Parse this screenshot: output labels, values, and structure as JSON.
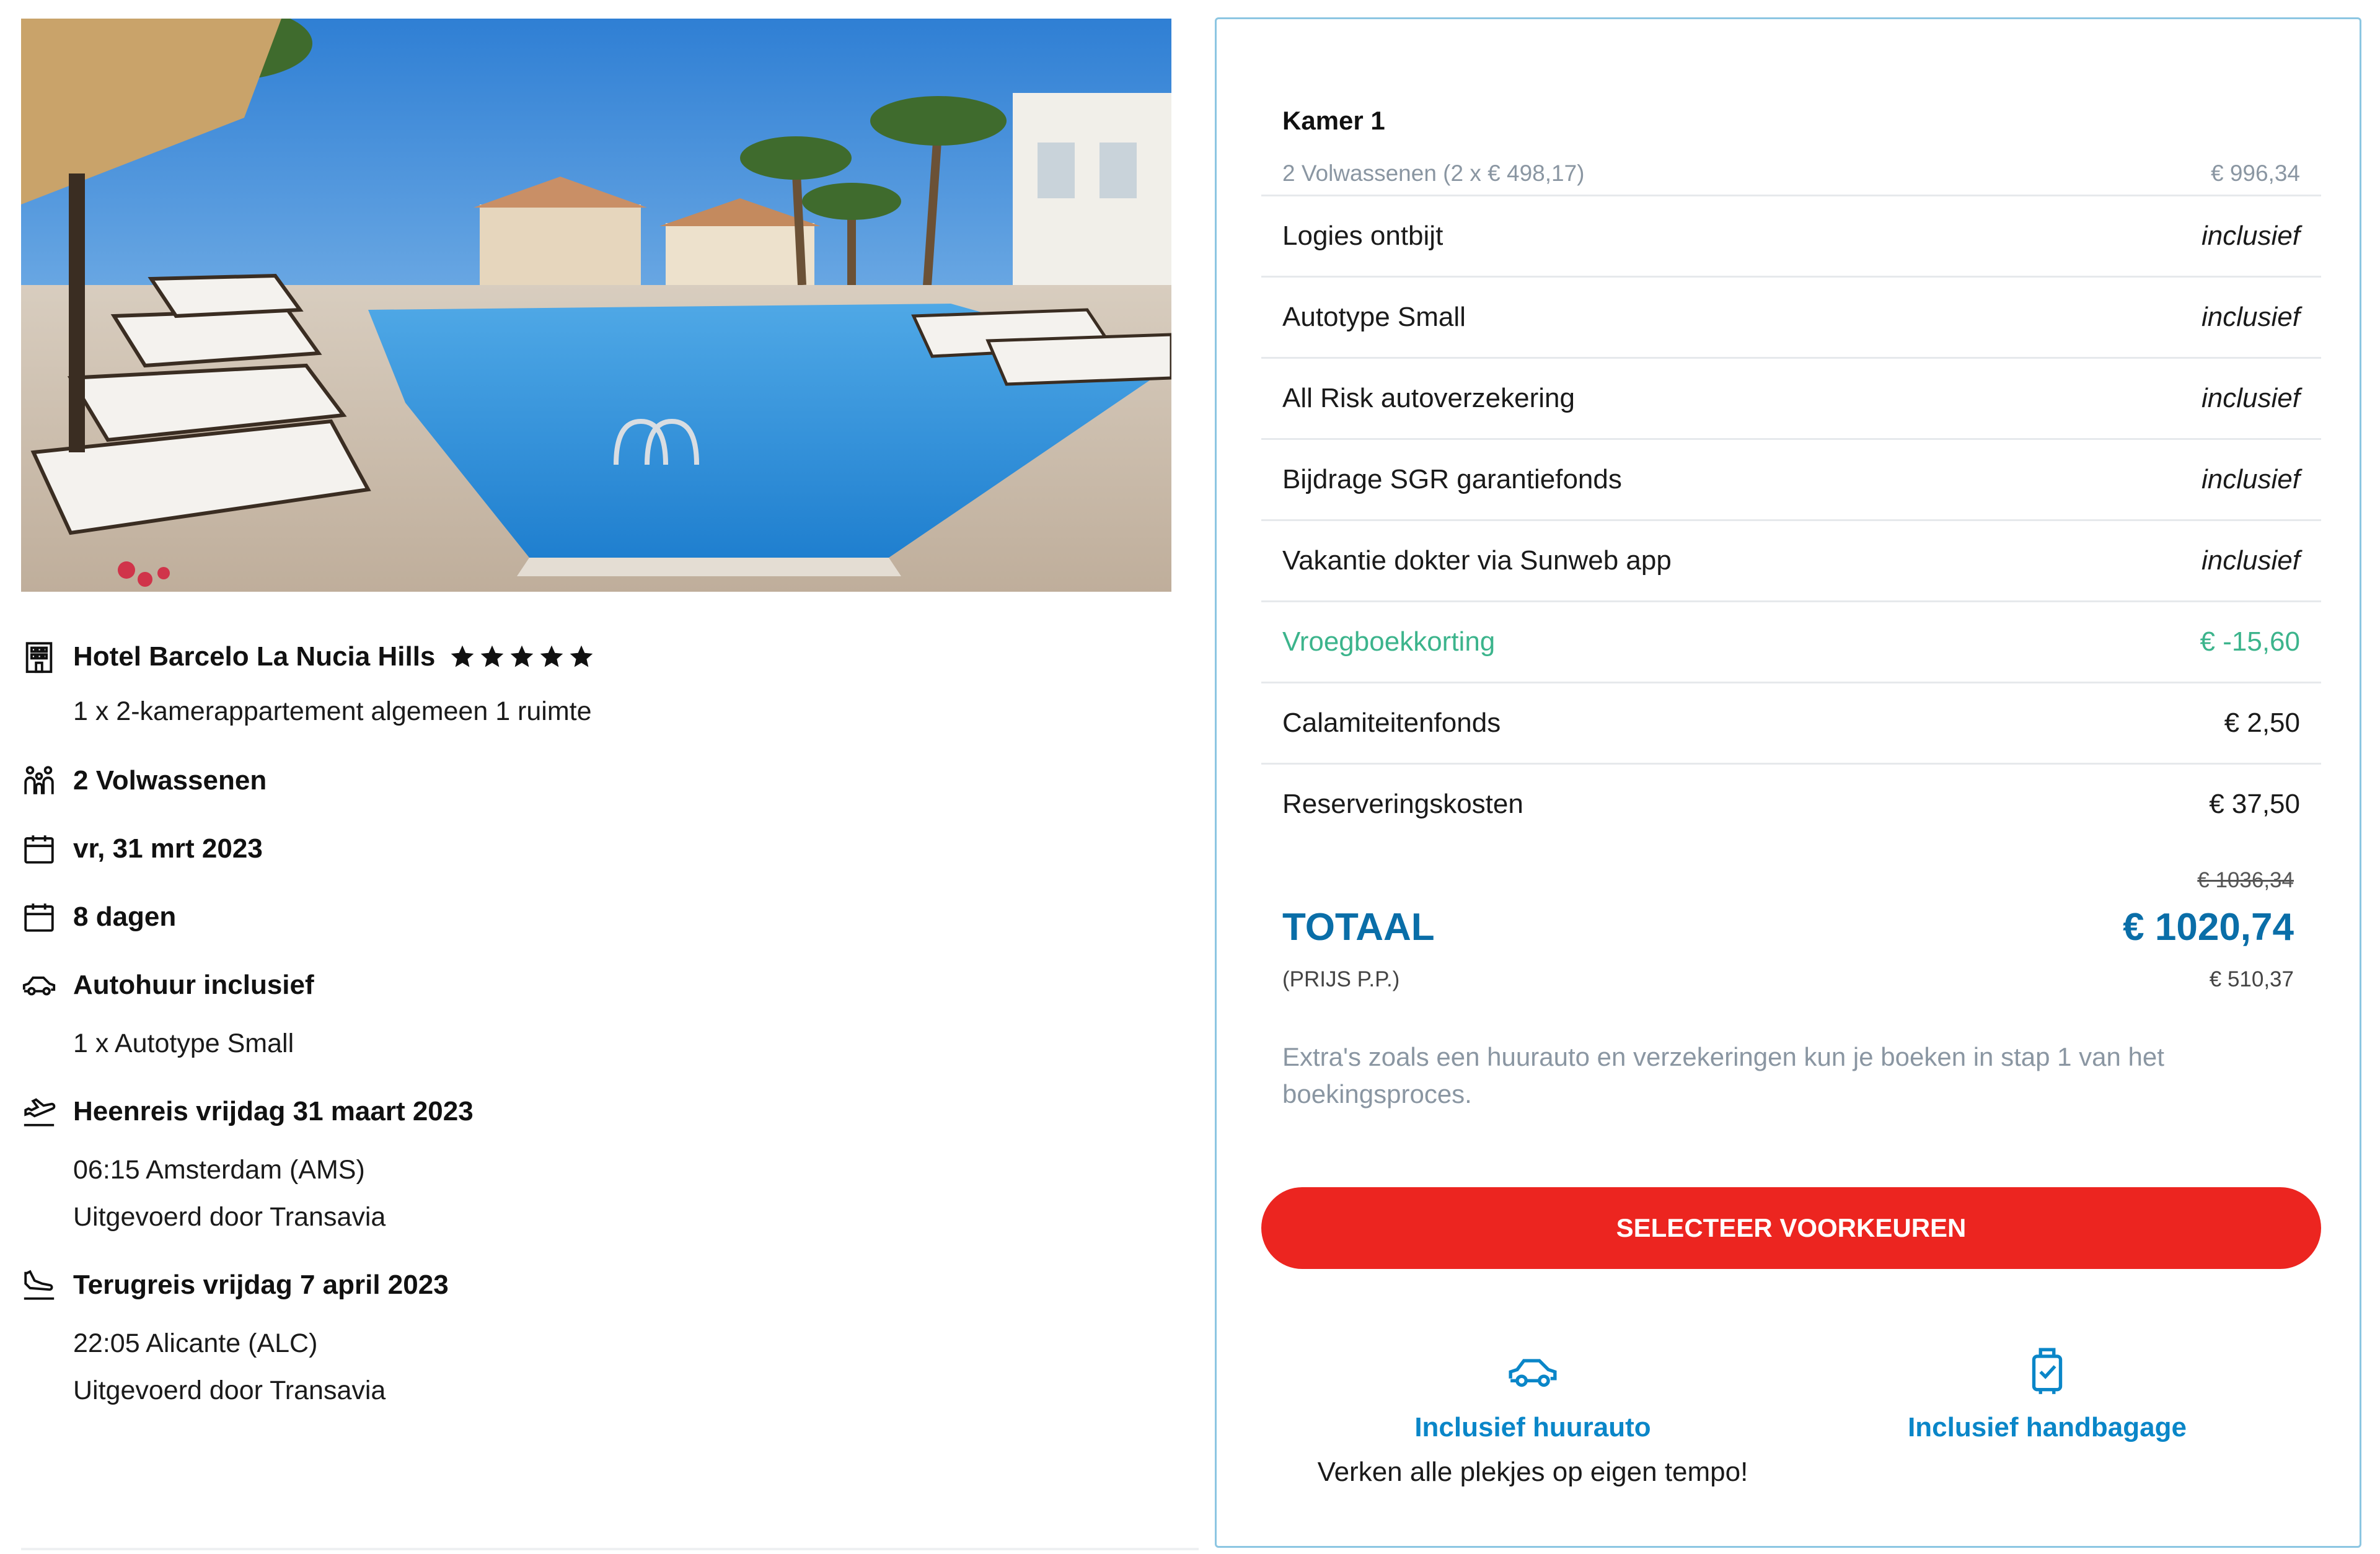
{
  "hotel_photo": {
    "icon": "hotel-pool-photo"
  },
  "details": {
    "hotel": {
      "icon": "building-icon",
      "name": "Hotel Barcelo La Nucia Hills",
      "stars": 5,
      "room": "1 x 2-kamerappartement algemeen 1 ruimte"
    },
    "travellers": {
      "icon": "people-icon",
      "label": "2 Volwassenen"
    },
    "date": {
      "icon": "calendar-icon",
      "label": "vr, 31 mrt 2023"
    },
    "duration": {
      "icon": "calendar-icon",
      "label": "8 dagen"
    },
    "car": {
      "icon": "car-icon",
      "label": "Autohuur inclusief",
      "sub": "1 x Autotype Small"
    },
    "outbound": {
      "icon": "plane-takeoff-icon",
      "label": "Heenreis vrijdag 31 maart 2023",
      "time": "06:15 Amsterdam (AMS)",
      "carrier": "Uitgevoerd door Transavia"
    },
    "return": {
      "icon": "plane-landing-icon",
      "label": "Terugreis vrijdag 7 april 2023",
      "time": "22:05 Alicante (ALC)",
      "carrier": "Uitgevoerd door Transavia"
    }
  },
  "price_card": {
    "room_title": "Kamer 1",
    "room_sub_label": "2 Volwassenen (2 x € 498,17)",
    "room_sub_value": "€ 996,34",
    "items": [
      {
        "label": "Logies ontbijt",
        "value": "inclusief"
      },
      {
        "label": "Autotype Small",
        "value": "inclusief"
      },
      {
        "label": "All Risk autoverzekering",
        "value": "inclusief"
      },
      {
        "label": "Bijdrage SGR garantiefonds",
        "value": "inclusief"
      },
      {
        "label": "Vakantie dokter via Sunweb app",
        "value": "inclusief"
      },
      {
        "label": "Vroegboekkorting",
        "value": "€ -15,60"
      },
      {
        "label": "Calamiteitenfonds",
        "value": "€ 2,50"
      },
      {
        "label": "Reserveringskosten",
        "value": "€ 37,50"
      }
    ],
    "old_total": "€ 1036,34",
    "total_label": "TOTAAL",
    "total_value": "€ 1020,74",
    "pp_label": "(PRIJS P.P.)",
    "pp_value": "€ 510,37",
    "extras_note": "Extra's zoals een huurauto en verzekeringen kun je boeken in stap 1 van het boekingsproces.",
    "cta_label": "SELECTEER VOORKEUREN",
    "features": [
      {
        "icon": "car-icon",
        "title": "Inclusief huurauto",
        "desc": "Verken alle plekjes op eigen tempo!"
      },
      {
        "icon": "luggage-check-icon",
        "title": "Inclusief handbagage",
        "desc": ""
      }
    ]
  },
  "colors": {
    "accent_blue": "#0a6ea8",
    "link_blue": "#0a86c8",
    "discount_green": "#3cb48c",
    "cta_red": "#ec2520",
    "card_border": "#8cc6e2",
    "muted_grey": "#8a96a2"
  }
}
